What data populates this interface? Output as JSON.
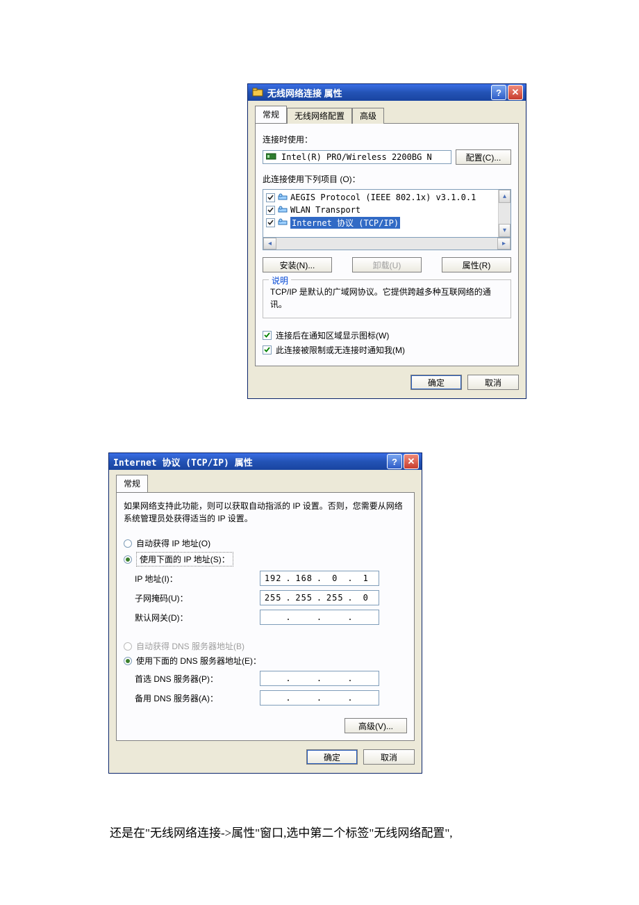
{
  "dialog1": {
    "title": "无线网络连接  属性",
    "tabs": {
      "general": "常规",
      "config": "无线网络配置",
      "advanced": "高级"
    },
    "connect_using_label": "连接时使用：",
    "adapter": "Intel(R) PRO/Wireless 2200BG N",
    "configure_btn": "配置(C)...",
    "items_label": "此连接使用下列项目 (O)：",
    "items": [
      {
        "label": "AEGIS Protocol (IEEE 802.1x) v3.1.0.1",
        "checked": true,
        "selected": false
      },
      {
        "label": "WLAN Transport",
        "checked": true,
        "selected": false
      },
      {
        "label": "Internet 协议 (TCP/IP)",
        "checked": true,
        "selected": true
      }
    ],
    "install_btn": "安装(N)...",
    "uninstall_btn": "卸载(U)",
    "properties_btn": "属性(R)",
    "desc_legend": "说明",
    "desc_text": "TCP/IP 是默认的广域网协议。它提供跨越多种互联网络的通讯。",
    "notify_icon": "连接后在通知区域显示图标(W)",
    "notify_limited": "此连接被限制或无连接时通知我(M)",
    "ok": "确定",
    "cancel": "取消"
  },
  "dialog2": {
    "title": "Internet 协议 (TCP/IP) 属性",
    "tab_general": "常规",
    "intro": "如果网络支持此功能，则可以获取自动指派的 IP 设置。否则，您需要从网络系统管理员处获得适当的 IP 设置。",
    "radio_auto_ip": "自动获得 IP 地址(O)",
    "radio_manual_ip": "使用下面的 IP 地址(S)：",
    "ip_label": "IP 地址(I)：",
    "ip_val": {
      "a": "192",
      "b": "168",
      "c": "0",
      "d": "1"
    },
    "mask_label": "子网掩码(U)：",
    "mask_val": {
      "a": "255",
      "b": "255",
      "c": "255",
      "d": "0"
    },
    "gw_label": "默认网关(D)：",
    "radio_auto_dns": "自动获得 DNS 服务器地址(B)",
    "radio_manual_dns": "使用下面的 DNS 服务器地址(E)：",
    "dns1_label": "首选 DNS 服务器(P)：",
    "dns2_label": "备用 DNS 服务器(A)：",
    "advanced_btn": "高级(V)...",
    "ok": "确定",
    "cancel": "取消"
  },
  "caption": "还是在\"无线网络连接->属性\"窗口,选中第二个标签\"无线网络配置\","
}
